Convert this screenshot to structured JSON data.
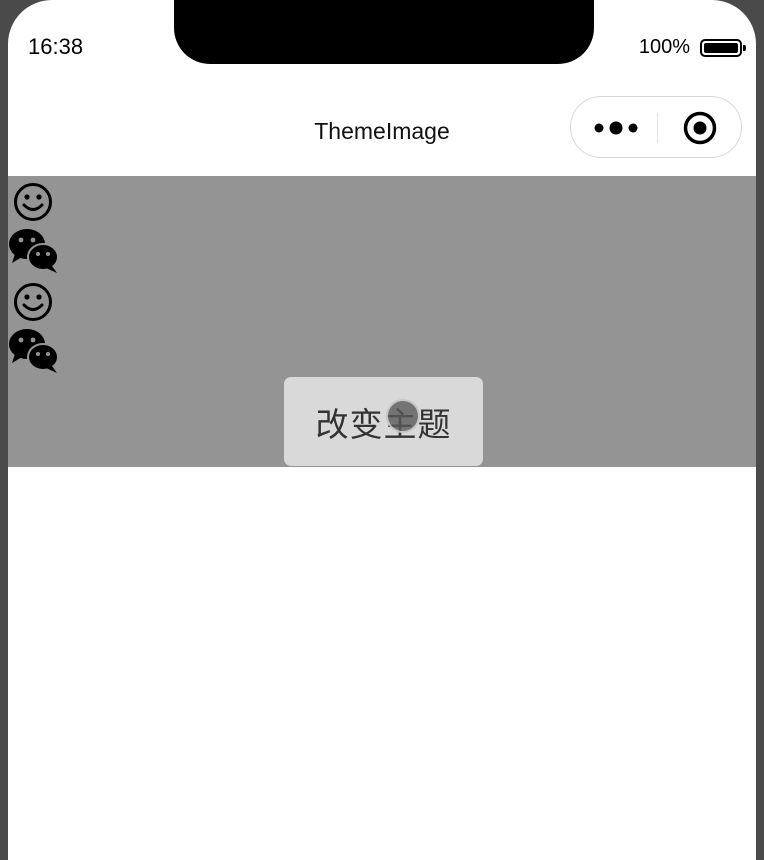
{
  "status_bar": {
    "time": "16:38",
    "battery": "100%"
  },
  "nav_bar": {
    "title": "ThemeImage"
  },
  "capsule": {
    "more_icon": "more-dots-icon",
    "close_icon": "target-close-icon"
  },
  "banner": {
    "background": "#949494",
    "icons": [
      "smiley-icon",
      "wechat-icon",
      "smiley-icon",
      "wechat-icon"
    ],
    "button_label": "改变主题"
  }
}
